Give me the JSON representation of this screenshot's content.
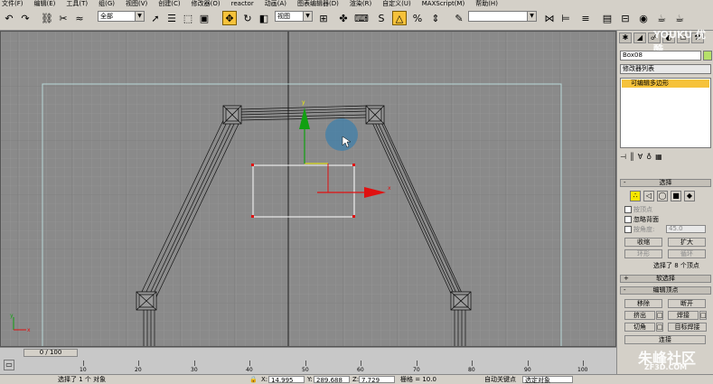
{
  "menu": [
    "文件(F)",
    "编辑(E)",
    "工具(T)",
    "组(G)",
    "视图(V)",
    "创建(C)",
    "修改器(O)",
    "reactor",
    "动画(A)",
    "图表编辑器(D)",
    "渲染(R)",
    "自定义(U)",
    "MAXScript(M)",
    "帮助(H)"
  ],
  "toolbar": {
    "selection_filter": "全部",
    "reference_coord": "视图",
    "named_selection": ""
  },
  "watermark": {
    "top": "YOUKU 优酷",
    "bottom_cn": "朱峰社区",
    "bottom_en": "ZF3D.COM"
  },
  "panel": {
    "object_name": "Box08",
    "object_color": "#b6e06a",
    "modifier_list": "修改器列表",
    "stack_item": "可编辑多边形",
    "selection_title": "选择",
    "by_vertex": "按顶点",
    "ignore_backface": "忽略背面",
    "by_angle": "按角度:",
    "angle_value": "45.0",
    "shrink": "收缩",
    "grow": "扩大",
    "ring": "环形",
    "loop": "循环",
    "selection_status": "选择了 8 个顶点",
    "soft_selection": "软选择",
    "edit_vertices": "编辑顶点",
    "remove": "移除",
    "break": "断开",
    "extrude": "挤出",
    "weld": "焊接",
    "chamfer": "切角",
    "target_weld": "目标焊接",
    "connect": "连接"
  },
  "timeline": {
    "frame_display": "0 / 100",
    "ticks": [
      "10",
      "20",
      "30",
      "40",
      "50",
      "60",
      "70",
      "80",
      "90",
      "100"
    ]
  },
  "status": {
    "selected": "选择了 1 个 对象",
    "x_label": "X:",
    "x_value": "14.995",
    "y_label": "Y:",
    "y_value": "289.688",
    "z_label": "Z:",
    "z_value": "7.729",
    "grid": "栅格 = 10.0",
    "autokey": "自动关键点",
    "selection_dropdown": "选定对象"
  },
  "colors": {
    "accent_active": "#f6c23a",
    "viewport_bg": "#8a8a8a",
    "axis_x": "#e01010",
    "axis_y": "#10a010"
  }
}
